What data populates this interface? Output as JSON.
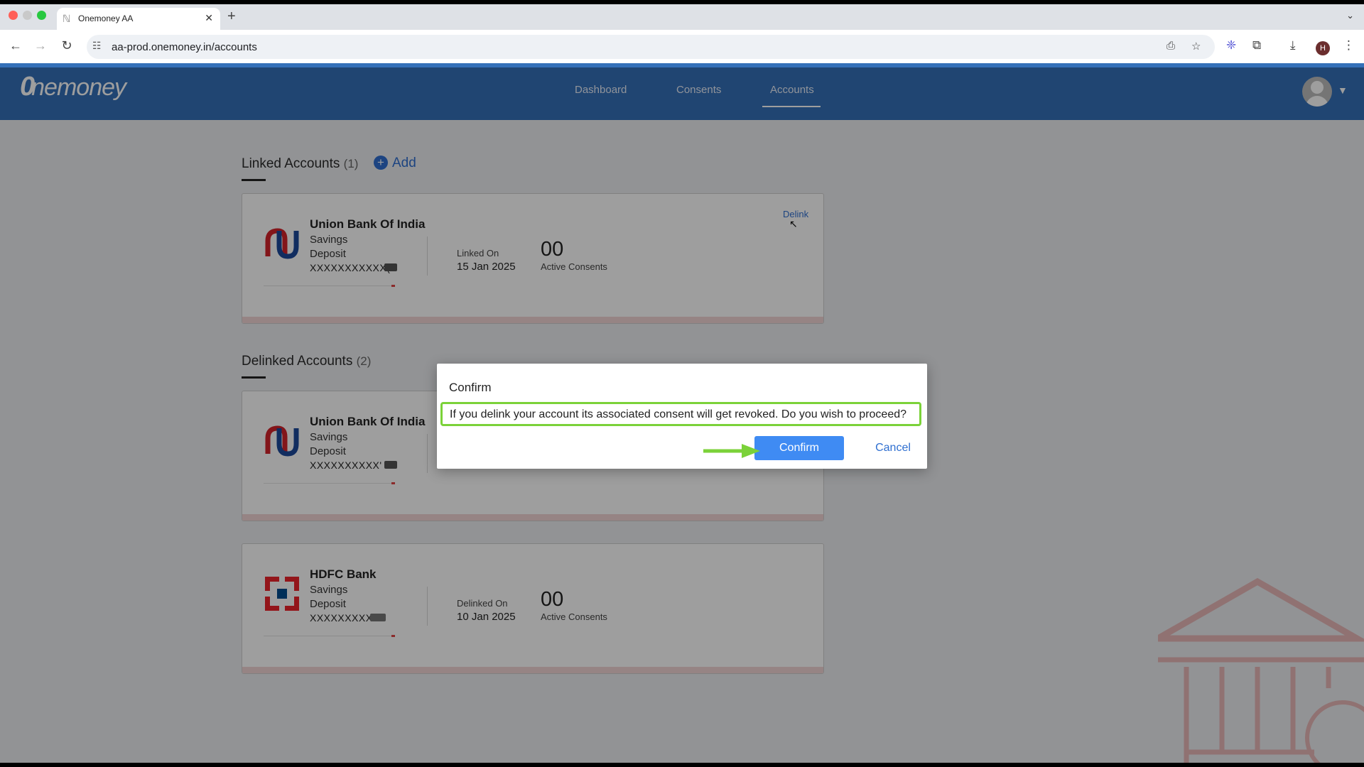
{
  "browser": {
    "tab_title": "Onemoney AA",
    "url": "aa-prod.onemoney.in/accounts",
    "profile_initial": "H"
  },
  "app": {
    "logo_text": "nemoney",
    "logo_mark": "0",
    "nav": [
      "Dashboard",
      "Consents",
      "Accounts"
    ],
    "active_nav": "Accounts"
  },
  "linked": {
    "title": "Linked Accounts",
    "count": "(1)",
    "add_label": "Add",
    "accounts": [
      {
        "bank": "Union Bank Of India",
        "type": "Savings",
        "sub": "Deposit",
        "account_no": "XXXXXXXXXXX(",
        "date_label": "Linked On",
        "date": "15 Jan 2025",
        "consents": "00",
        "consents_label": "Active Consents",
        "action": "Delink"
      }
    ]
  },
  "delinked": {
    "title": "Delinked Accounts",
    "count": "(2)",
    "accounts": [
      {
        "bank": "Union Bank Of India",
        "type": "Savings",
        "sub": "Deposit",
        "account_no": "XXXXXXXXXX'"
      },
      {
        "bank": "HDFC Bank",
        "type": "Savings",
        "sub": "Deposit",
        "account_no": "XXXXXXXXX",
        "date_label": "Delinked On",
        "date": "10 Jan 2025",
        "consents": "00",
        "consents_label": "Active Consents"
      }
    ]
  },
  "dialog": {
    "title": "Confirm",
    "message": "If you delink your account its associated consent will get revoked. Do you wish to proceed?",
    "confirm_label": "Confirm",
    "cancel_label": "Cancel"
  },
  "colors": {
    "appbar": "#3470b8",
    "accent": "#3f8bf3",
    "highlight": "#7bd239"
  }
}
